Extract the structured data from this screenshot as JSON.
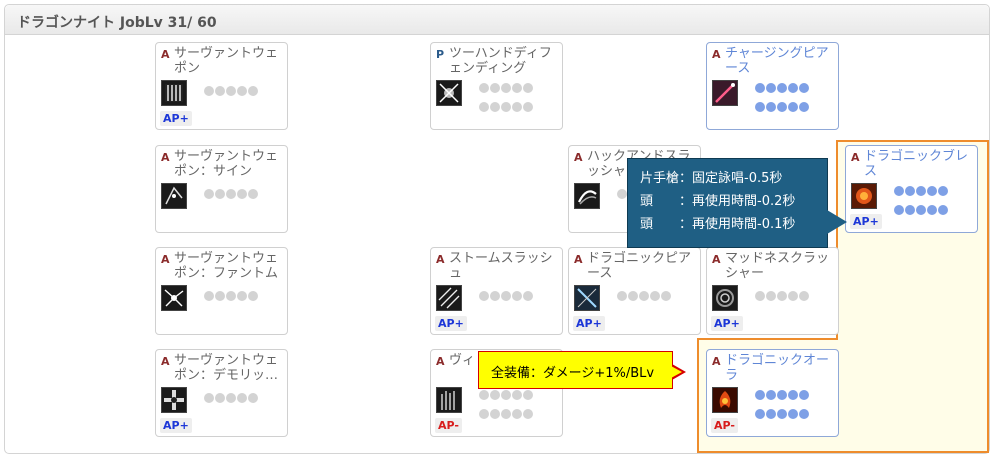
{
  "panel": {
    "title": "ドラゴンナイト JobLv 31/ 60"
  },
  "skills": [
    {
      "id": "s1",
      "type": "A",
      "name": "サーヴァントウェポン",
      "icon": "spear-array-icon",
      "dots": 5,
      "rows": 1,
      "ap": "AP+",
      "active": false
    },
    {
      "id": "s2",
      "type": "P",
      "name": "ツーハンドディフェンディング",
      "icon": "spear-guard-icon",
      "dots": 10,
      "rows": 2,
      "ap": "",
      "active": false
    },
    {
      "id": "s3",
      "type": "A",
      "name": "チャージングピアース",
      "icon": "pierce-icon",
      "dots": 10,
      "rows": 2,
      "ap": "",
      "active": true
    },
    {
      "id": "s4",
      "type": "A",
      "name": "サーヴァントウェポン：サイン",
      "icon": "sign-icon",
      "dots": 5,
      "rows": 1,
      "ap": "",
      "active": false
    },
    {
      "id": "s5",
      "type": "A",
      "name": "ハックアンドスラッシャー",
      "icon": "slash-icon",
      "dots": 5,
      "rows": 1,
      "ap": "",
      "active": false
    },
    {
      "id": "s6",
      "type": "A",
      "name": "ドラゴニックブレス",
      "icon": "dragon-breath-icon",
      "dots": 10,
      "rows": 2,
      "ap": "AP+",
      "active": true
    },
    {
      "id": "s7",
      "type": "A",
      "name": "サーヴァントウェポン：ファントム",
      "icon": "phantom-icon",
      "dots": 5,
      "rows": 1,
      "ap": "",
      "active": false
    },
    {
      "id": "s8",
      "type": "A",
      "name": "ストームスラッシュ",
      "icon": "storm-icon",
      "dots": 5,
      "rows": 1,
      "ap": "AP+",
      "active": false
    },
    {
      "id": "s9",
      "type": "A",
      "name": "ドラゴニックピアース",
      "icon": "dragon-pierce-icon",
      "dots": 5,
      "rows": 1,
      "ap": "AP+",
      "active": false
    },
    {
      "id": "s10",
      "type": "A",
      "name": "マッドネスクラッシャー",
      "icon": "madness-icon",
      "dots": 5,
      "rows": 1,
      "ap": "AP+",
      "active": false
    },
    {
      "id": "s11",
      "type": "A",
      "name": "サーヴァントウェポン：デモリッ…",
      "icon": "demolition-icon",
      "dots": 5,
      "rows": 1,
      "ap": "AP+",
      "active": false
    },
    {
      "id": "s12",
      "type": "A",
      "name": "ヴィ",
      "icon": "vigor-icon",
      "dots": 10,
      "rows": 2,
      "ap": "AP-",
      "active": false
    },
    {
      "id": "s13",
      "type": "A",
      "name": "ドラゴニックオーラ",
      "icon": "dragon-aura-icon",
      "dots": 10,
      "rows": 2,
      "ap": "AP-",
      "active": true
    }
  ],
  "tooltip_blue": {
    "lines": [
      "片手槍：固定詠唱-0.5秒",
      "頭　　：再使用時間-0.2秒",
      "頭　　：再使用時間-0.1秒"
    ]
  },
  "tooltip_yellow": {
    "text": "全装備：ダメージ+1%/BLv"
  },
  "colors": {
    "highlight_border": "#ee8c2c",
    "highlight_fill": "#fffde8",
    "tooltip_blue": "#1f5f84",
    "tooltip_yellow": "#ffff00",
    "dot_active": "#7ea0e6",
    "dot_inactive": "#d3d3d3"
  }
}
